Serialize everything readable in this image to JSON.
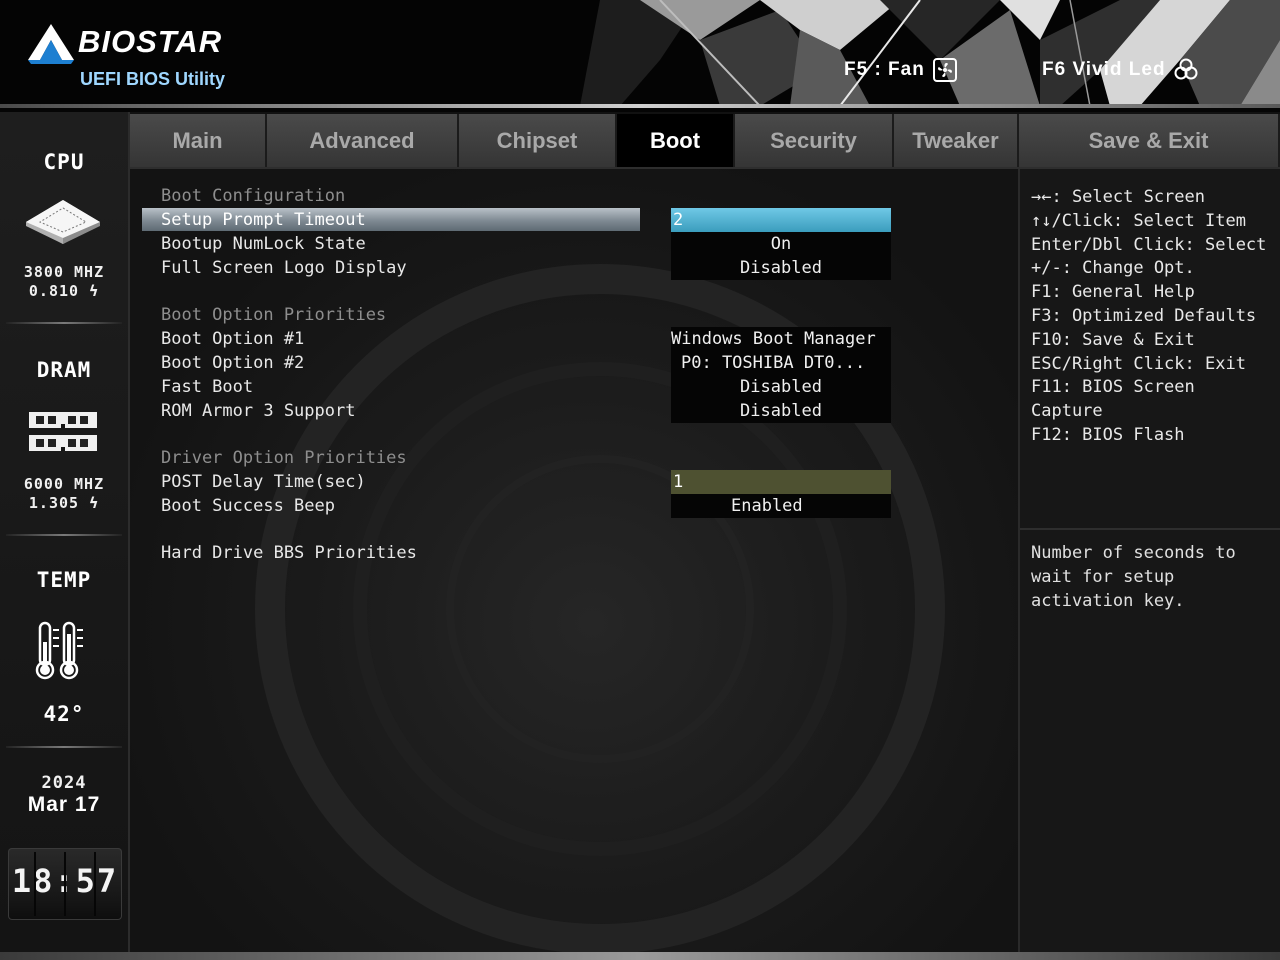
{
  "brand": {
    "name": "BIOSTAR",
    "subtitle": "UEFI BIOS Utility"
  },
  "hotkeys": {
    "fan": "F5 : Fan",
    "led": "F6  Vivid Led"
  },
  "sidebar": {
    "cpu_title": "CPU",
    "cpu_freq": "3800 MHZ",
    "cpu_volt": "0.810 ϟ",
    "dram_title": "DRAM",
    "dram_freq": "6000 MHZ",
    "dram_volt": "1.305 ϟ",
    "temp_title": "TEMP",
    "temp_value": "42°",
    "year": "2024",
    "date": "Mar  17",
    "time": "18:57"
  },
  "tabs": [
    {
      "label": "Main"
    },
    {
      "label": "Advanced"
    },
    {
      "label": "Chipset"
    },
    {
      "label": "Boot",
      "active": true
    },
    {
      "label": "Security"
    },
    {
      "label": "Tweaker"
    },
    {
      "label": "Save & Exit"
    }
  ],
  "boot": {
    "boot_config_header": "Boot Configuration",
    "setup_prompt_label": "Setup Prompt Timeout",
    "setup_prompt_value": "2",
    "numlock_label": "Bootup NumLock State",
    "numlock_value": "On",
    "fullscreen_label": "Full Screen Logo Display",
    "fullscreen_value": "Disabled",
    "boot_priorities_header": "Boot Option Priorities",
    "boot_opt1_label": "Boot Option #1",
    "boot_opt1_value": "Windows Boot Manager",
    "boot_opt2_label": "Boot Option #2",
    "boot_opt2_value": "P0: TOSHIBA DT0...",
    "fast_boot_label": "Fast Boot",
    "fast_boot_value": "Disabled",
    "rom_armor_label": "ROM Armor 3 Support",
    "rom_armor_value": "Disabled",
    "driver_priorities_header": "Driver Option Priorities",
    "post_delay_label": "POST Delay Time(sec)",
    "post_delay_value": "1",
    "beep_label": "Boot Success Beep",
    "beep_value": "Enabled",
    "hdd_bbs_label": "Hard Drive BBS Priorities"
  },
  "help": {
    "keys": [
      "→←: Select Screen",
      "↑↓/Click: Select Item",
      "Enter/Dbl Click: Select",
      "+/-: Change Opt.",
      "F1: General Help",
      "F3: Optimized Defaults",
      "F10: Save & Exit",
      "ESC/Right Click: Exit",
      "F11: BIOS Screen",
      "Capture",
      "F12: BIOS Flash"
    ],
    "description": "Number of seconds to wait for setup activation key."
  },
  "colors": {
    "selected_value_bg": "#4fb3d6",
    "edit_value_bg": "#4e5131",
    "active_tab_bg": "#000000",
    "inactive_tab_bg": "#404040",
    "logo_subtitle": "#9fd7ff"
  }
}
